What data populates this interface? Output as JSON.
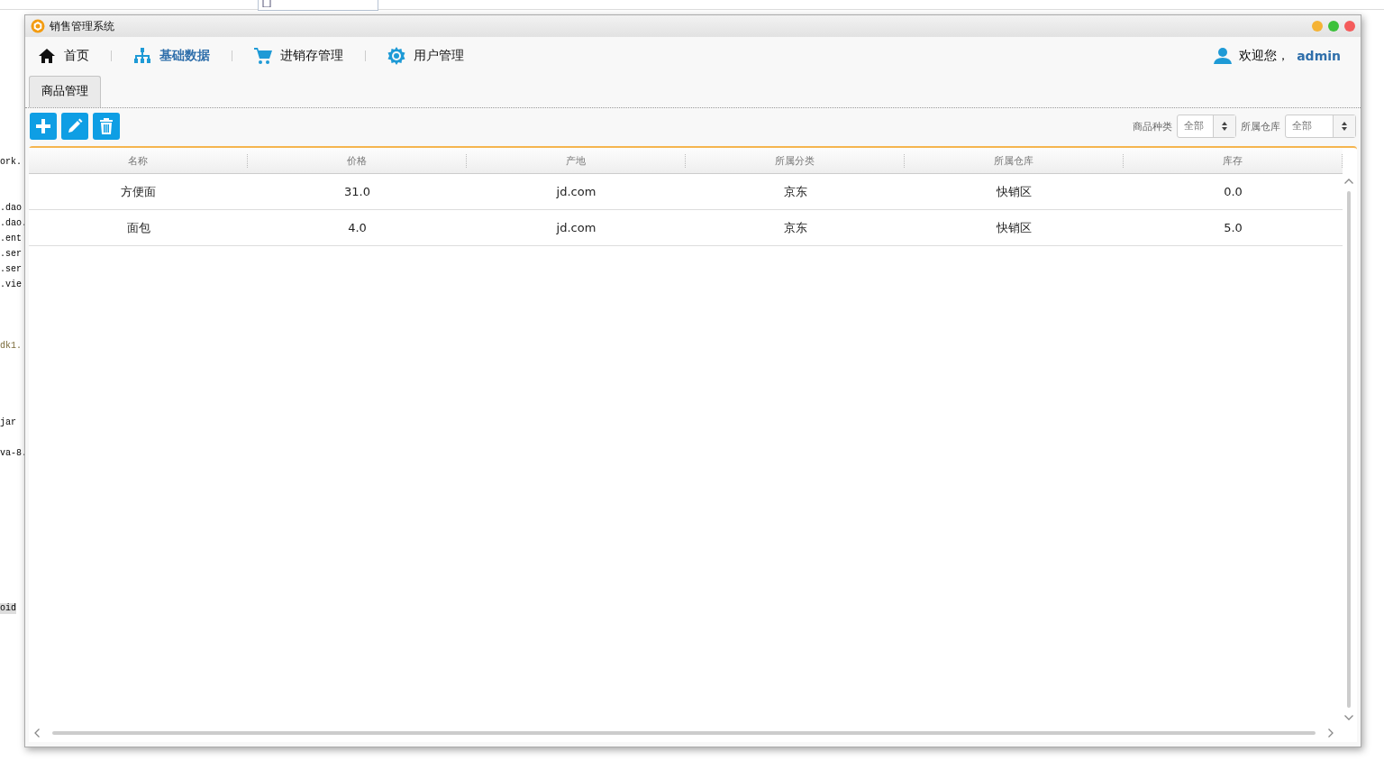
{
  "background": {
    "fragments": [
      {
        "text": "ork."
      },
      {
        "text": ".dao"
      },
      {
        "text": ".dao."
      },
      {
        "text": ".ent"
      },
      {
        "text": ".ser"
      },
      {
        "text": ".ser"
      },
      {
        "text": ".vie"
      },
      {
        "text": "dk1."
      },
      {
        "text": "jar"
      },
      {
        "text": "va-8."
      },
      {
        "text": "oid"
      }
    ]
  },
  "window": {
    "title": "销售管理系统"
  },
  "nav": {
    "items": [
      {
        "kind": "home",
        "label": "首页",
        "selected": false
      },
      {
        "kind": "tree",
        "label": "基础数据",
        "selected": true
      },
      {
        "kind": "cart",
        "label": "进销存管理",
        "selected": false
      },
      {
        "kind": "gear",
        "label": "用户管理",
        "selected": false
      }
    ],
    "user": {
      "greeting": "欢迎您，",
      "name": "admin"
    }
  },
  "tabs": [
    {
      "label": "商品管理",
      "selected": true
    }
  ],
  "toolbar": {
    "buttons": [
      {
        "kind": "add"
      },
      {
        "kind": "edit"
      },
      {
        "kind": "delete"
      }
    ],
    "filters": [
      {
        "label": "商品种类",
        "value": "全部"
      },
      {
        "label": "所属仓库",
        "value": "全部"
      }
    ]
  },
  "table": {
    "columns": [
      "名称",
      "价格",
      "产地",
      "所属分类",
      "所属仓库",
      "库存"
    ],
    "rows": [
      [
        "方便面",
        "31.0",
        "jd.com",
        "京东",
        "快销区",
        "0.0"
      ],
      [
        "面包",
        "4.0",
        "jd.com",
        "京东",
        "快销区",
        "5.0"
      ]
    ]
  }
}
